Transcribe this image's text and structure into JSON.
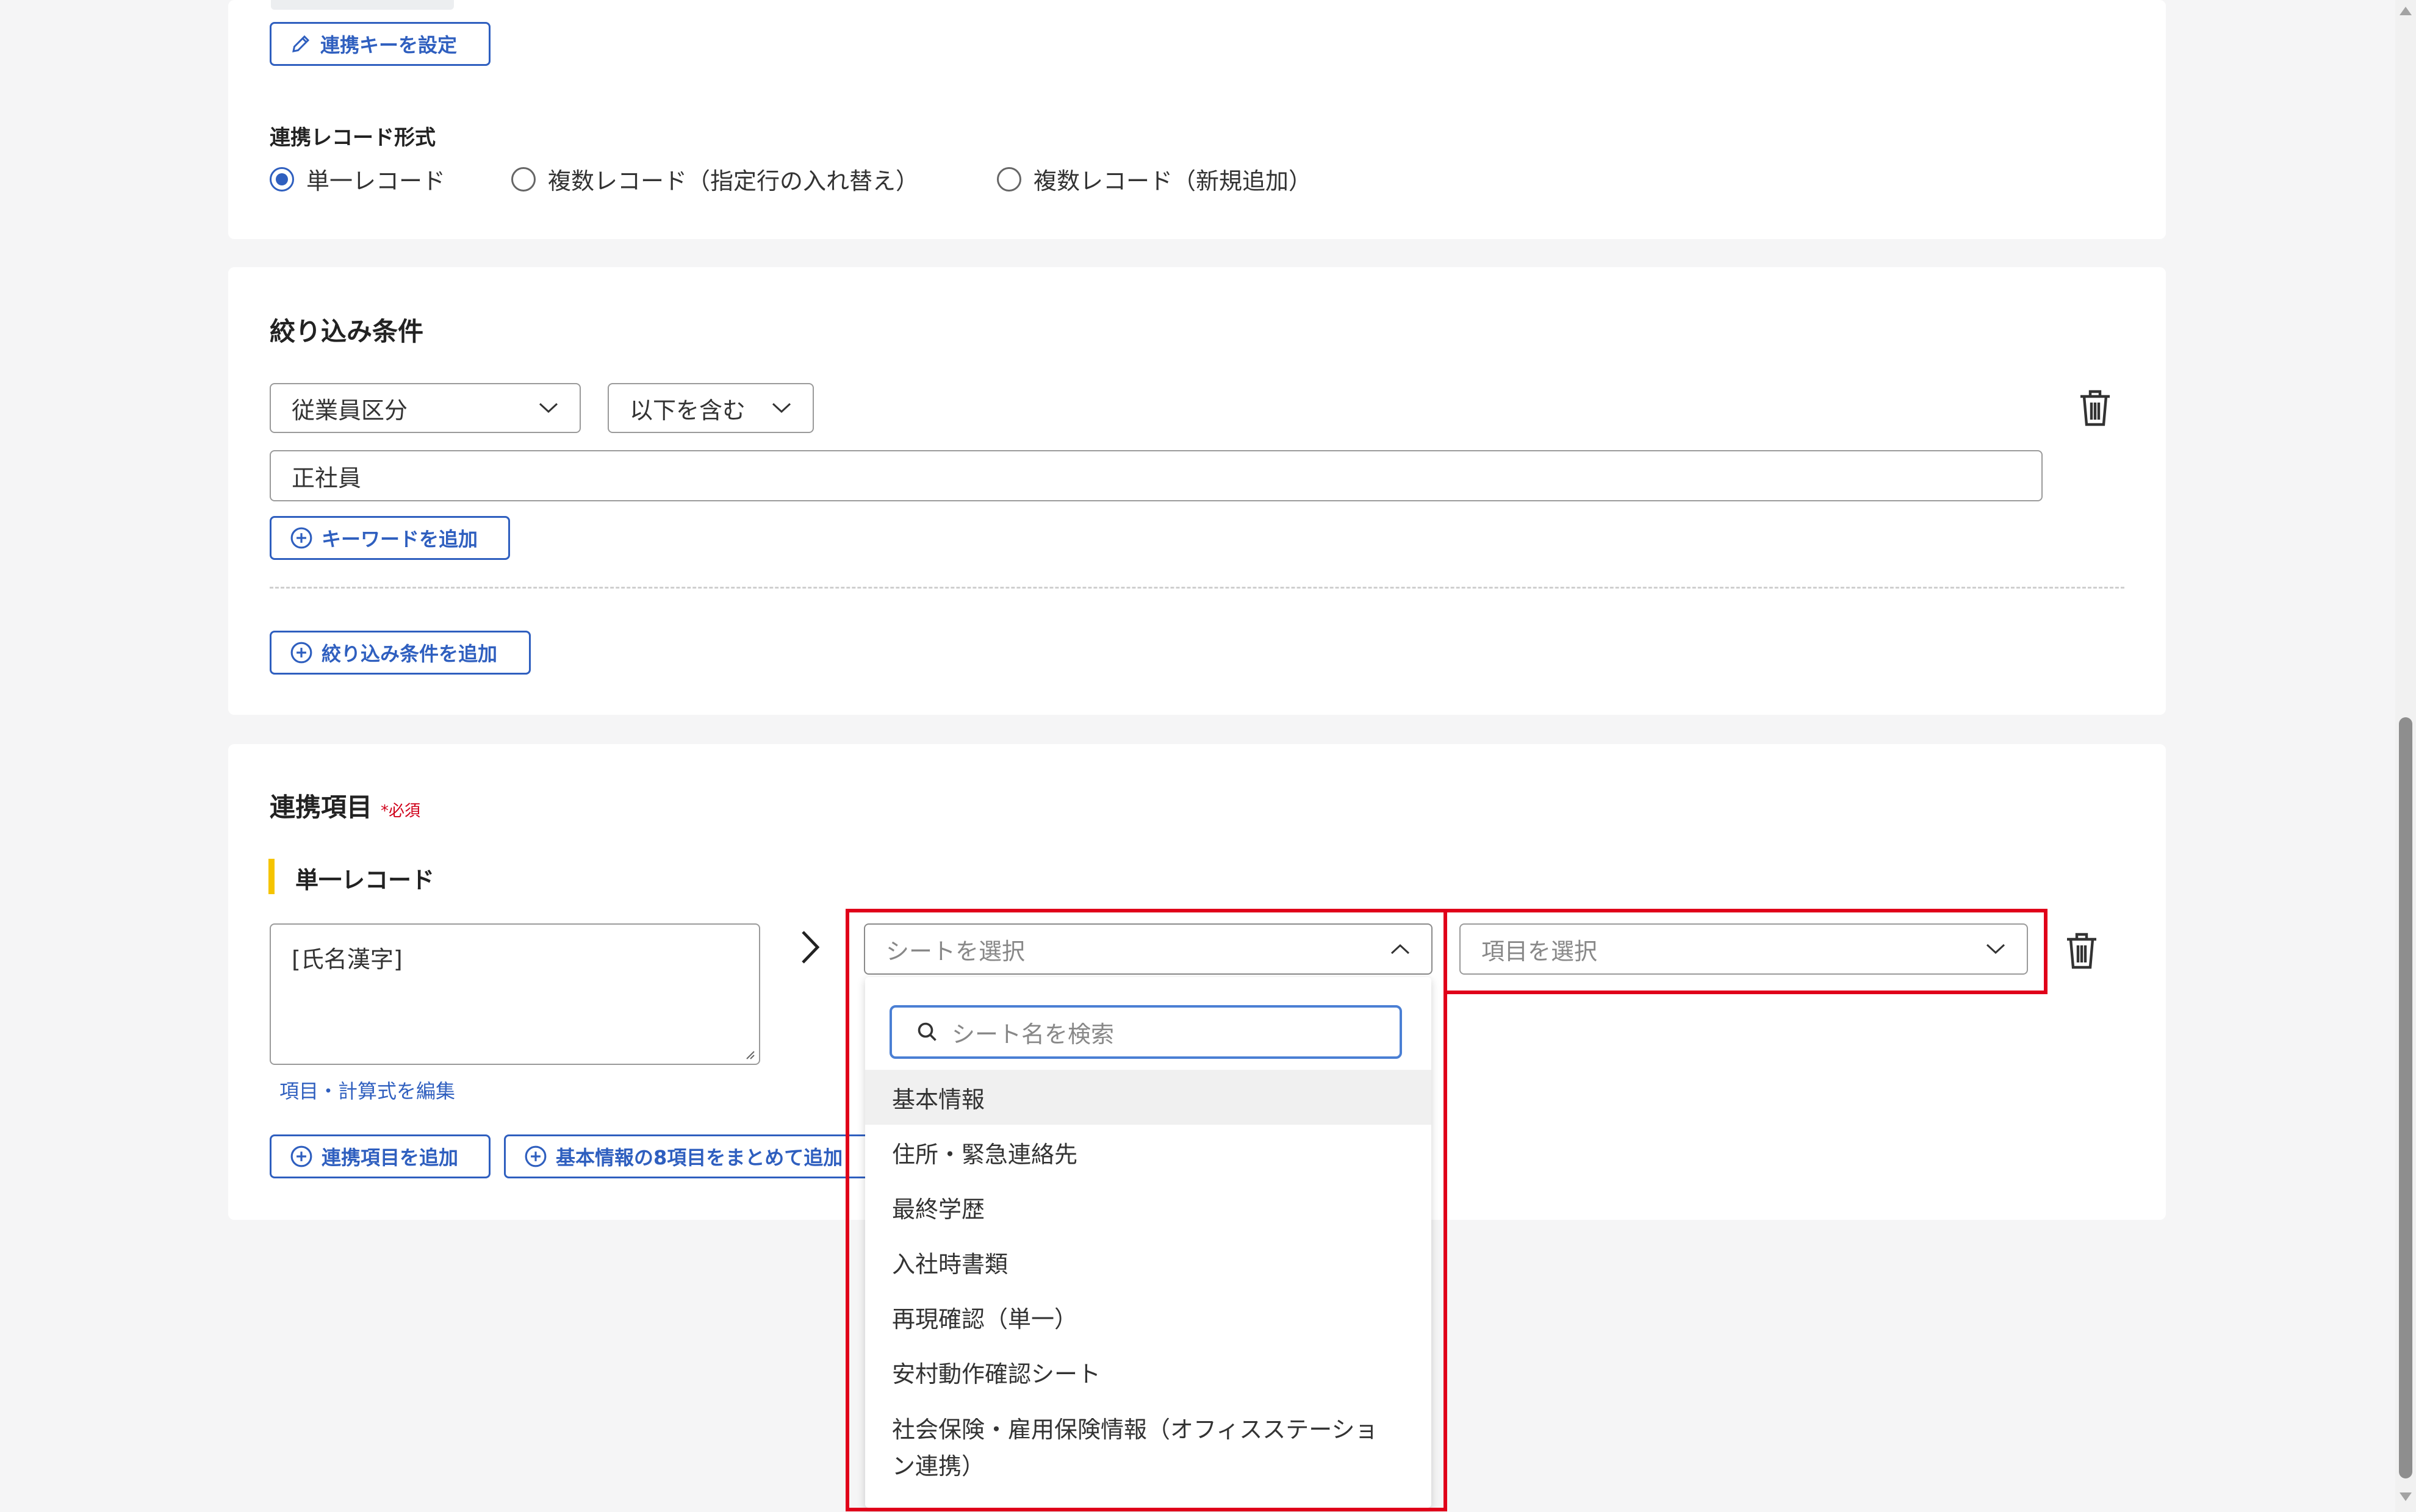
{
  "top_card": {
    "set_key_button": "連携キーを設定",
    "record_format_label": "連携レコード形式",
    "record_format_options": [
      "単一レコード",
      "複数レコード（指定行の入れ替え）",
      "複数レコード（新規追加）"
    ],
    "record_format_selected": "単一レコード"
  },
  "filter_card": {
    "title": "絞り込み条件",
    "field_select": "従業員区分",
    "operator_select": "以下を含む",
    "keyword_value": "正社員",
    "add_keyword_button": "キーワードを追加",
    "add_condition_button": "絞り込み条件を追加"
  },
  "link_card": {
    "title": "連携項目",
    "required_badge": "*必須",
    "section_label": "単一レコード",
    "source_text": "[氏名漢字]",
    "edit_link": "項目・計算式を編集",
    "sheet_select_placeholder": "シートを選択",
    "item_select_placeholder": "項目を選択",
    "add_item_button": "連携項目を追加",
    "add_bulk_button": "基本情報の8項目をまとめて追加"
  },
  "dropdown": {
    "search_placeholder": "シート名を検索",
    "items": [
      "基本情報",
      "住所・緊急連絡先",
      "最終学歴",
      "入社時書類",
      "再現確認（単一）",
      "安村動作確認シート",
      "社会保険・雇用保険情報（オフィスステーショ",
      "ン連携）"
    ],
    "highlighted": "基本情報"
  },
  "colors": {
    "accent": "#2f5fbf",
    "highlight_box": "#e0001a",
    "required": "#d0021b",
    "section_bar": "#f5c400"
  }
}
